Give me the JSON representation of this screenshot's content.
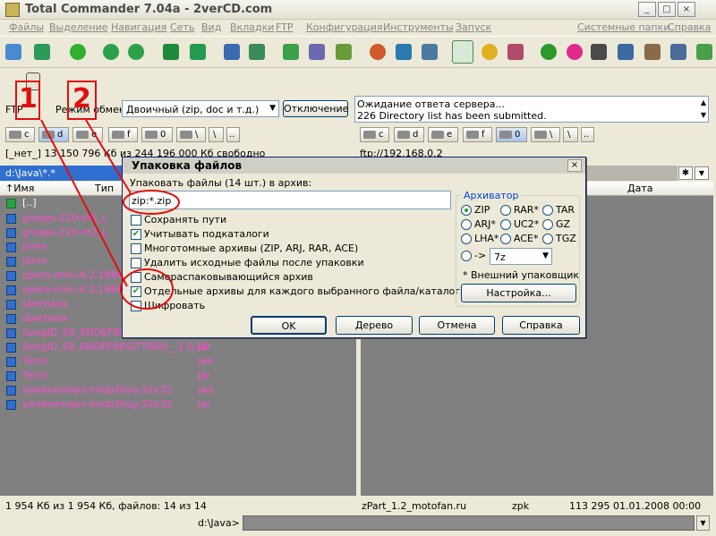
{
  "app": {
    "title": "Total Commander 7.04a - 2verCD.com",
    "win_buttons": [
      "_",
      "□",
      "×"
    ]
  },
  "menu": [
    "Файлы",
    "Выделение",
    "Навигация",
    "Сеть",
    "Вид",
    "Вкладки",
    "FTP",
    "Конфигурация",
    "Инструменты",
    "Запуск",
    "Системные папки",
    "Справка"
  ],
  "ftp": {
    "label": "FTP",
    "mode_label": "Режим обмена",
    "mode_value": "Двоичный (zip, doc и т.д.)",
    "disconnect": "Отключение",
    "log_line1": "Ожидание ответа сервера...",
    "log_line2": "226 Directory list has been submitted."
  },
  "drives": {
    "c": "c",
    "d": "d",
    "e": "e",
    "f": "f",
    "zero": "0",
    "net": "\\",
    "dots": ".."
  },
  "left": {
    "status": "[_нет_]  13 150 796 Кб из 244 196 000 Кб свободно",
    "path": "d:\\Java\\*.*",
    "col_name": "↑Имя",
    "col_type": "Тип",
    "files": [
      {
        "name": "[..]",
        "ext": ""
      },
      {
        "name": "gmaps-220-m2_L",
        "ext": ""
      },
      {
        "name": "gmaps-220-m2_L",
        "ext": ""
      },
      {
        "name": "jimm",
        "ext": ""
      },
      {
        "name": "jimm",
        "ext": ""
      },
      {
        "name": "opera-mini-4.2.18887",
        "ext": ""
      },
      {
        "name": "opera-mini-4.2.18887",
        "ext": ""
      },
      {
        "name": "sberbank",
        "ext": ""
      },
      {
        "name": "sberbank",
        "ext": ""
      },
      {
        "name": "SongID_E8_ENDEFRESIT",
        "ext": ""
      },
      {
        "name": "SongID_E8_ENDEFRESITTRRU__1.0.10",
        "ext": "jar"
      },
      {
        "name": "Tetris",
        "ext": "jad"
      },
      {
        "name": "Tetris",
        "ext": "jar"
      },
      {
        "name": "yandexmaps-midp2bsg-32x32",
        "ext": "jad"
      },
      {
        "name": "yandexmaps-midp2bsg-32x32",
        "ext": "jar"
      }
    ],
    "summary": "1 954 Кб из 1 954 Кб, файлов: 14 из 14"
  },
  "right": {
    "status": "ftp://192.168.0.2",
    "col_date": "Дата",
    "summary_name": "zPart_1.2_motofan.ru",
    "summary_ext": "zpk",
    "summary_size": "113 295",
    "summary_date": "01.01.2008 00:00"
  },
  "cmd": {
    "prompt": "d:\\Java>"
  },
  "dialog": {
    "title": "Упаковка файлов",
    "prompt": "Упаковать файлы (14 шт.) в архив:",
    "archive_value": "zip:*.zip",
    "options": [
      {
        "label": "Сохранять пути",
        "checked": false
      },
      {
        "label": "Учитывать подкаталоги",
        "checked": true
      },
      {
        "label": "Многотомные архивы (ZIP, ARJ, RAR, ACE)",
        "checked": false
      },
      {
        "label": "Удалить исходные файлы после упаковки",
        "checked": false
      },
      {
        "label": "Самораспаковывающийся архив",
        "checked": false
      },
      {
        "label": "Отдельные архивы для каждого выбранного файла/каталога",
        "checked": true
      },
      {
        "label": "Шифровать",
        "checked": false
      }
    ],
    "archiver_group": "Архиватор",
    "archivers": [
      "ZIP",
      "RAR*",
      "TAR",
      "ARJ*",
      "UC2*",
      "GZ",
      "LHA*",
      "ACE*",
      "TGZ"
    ],
    "archiver_selected": "ZIP",
    "other_arrow": "->",
    "other_value": "7z",
    "external_note": "* Внешний упаковщик",
    "settings_btn": "Настройка...",
    "buttons": {
      "ok": "OK",
      "tree": "Дерево",
      "cancel": "Отмена",
      "help": "Справка"
    }
  },
  "annotations": {
    "num1": "1",
    "num2": "2"
  },
  "colors": {
    "accent": "#2f6fd0",
    "file_pink": "#ff4ad0",
    "annotation_red": "#e01010"
  }
}
